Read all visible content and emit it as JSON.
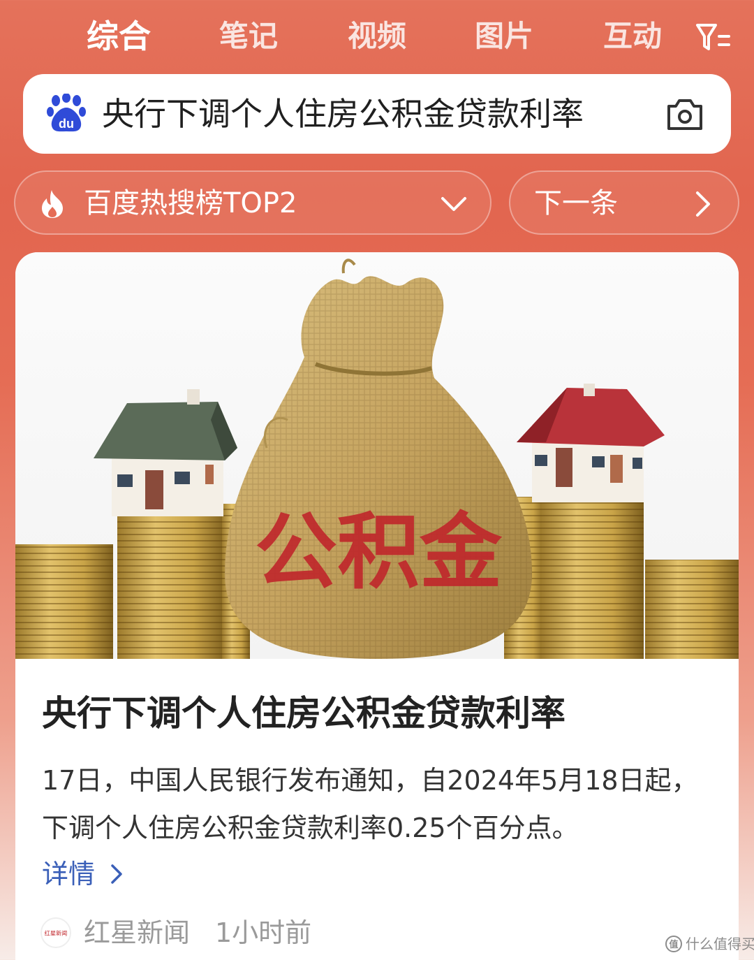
{
  "tabs": [
    {
      "label": "综合",
      "active": true
    },
    {
      "label": "笔记",
      "active": false
    },
    {
      "label": "视频",
      "active": false
    },
    {
      "label": "图片",
      "active": false
    },
    {
      "label": "互动",
      "active": false
    }
  ],
  "filter_icon": "filter-icon",
  "search": {
    "query": "央行下调个人住房公积金贷款利率",
    "logo_icon": "baidu-paw-icon",
    "camera_icon": "camera-icon"
  },
  "hot": {
    "label": "百度热搜榜TOP2",
    "icon": "flame-icon",
    "next_label": "下一条"
  },
  "card": {
    "image_text": "公积金",
    "title": "央行下调个人住房公积金贷款利率",
    "summary": "17日，中国人民银行发布通知，自2024年5月18日起，下调个人住房公积金贷款利率0.25个百分点。",
    "detail_label": "详情",
    "source": "红星新闻",
    "source_logo_text": "红星新闻",
    "time": "1小时前"
  },
  "watermark": "什么值得买",
  "colors": {
    "accent_red": "#e2654f",
    "link_blue": "#3a5fb8",
    "baidu_blue": "#2f4bd8"
  }
}
